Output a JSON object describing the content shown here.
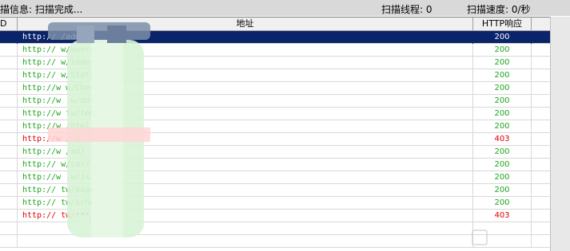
{
  "status": {
    "info": "描信息: 扫描完成...",
    "threads": "扫描线程: 0",
    "speed": "扫描速度: 0/秒"
  },
  "columns": {
    "id": "D",
    "address": "地址",
    "http": "HTTP响应"
  },
  "rows": [
    {
      "address": "http://                        /admin/",
      "http": "200",
      "state": "selected"
    },
    {
      "address": "http://                       w/users/",
      "http": "200",
      "state": "ok"
    },
    {
      "address": "http://                       w/index.htm",
      "http": "200",
      "state": "ok"
    },
    {
      "address": "http://                       w/Stats/",
      "http": "200",
      "state": "ok"
    },
    {
      "address": "http://w                      w/Check/",
      "http": "200",
      "state": "ok"
    },
    {
      "address": "http://w                      .w/docs/",
      "http": "200",
      "state": "ok"
    },
    {
      "address": "http://w                      tw/temp/",
      "http": "200",
      "state": "ok"
    },
    {
      "address": "http://w                       /html/",
      "http": "200",
      "state": "ok"
    },
    {
      "address": "http://w                       /cgi-bin/",
      "http": "403",
      "state": "err"
    },
    {
      "address": "http://w                       /ad/",
      "http": "200",
      "state": "ok"
    },
    {
      "address": "http://                       w/car/",
      "http": "200",
      "state": "ok"
    },
    {
      "address": "http://w                      .w/Js/",
      "http": "200",
      "state": "ok"
    },
    {
      "address": "http://                       tw/pages/",
      "http": "200",
      "state": "ok"
    },
    {
      "address": "http://                       tw/school/",
      "http": "200",
      "state": "ok"
    },
    {
      "address": "http://                       tw/***/",
      "http": "403",
      "state": "err"
    }
  ],
  "colors": {
    "ok": "#1ea51e",
    "error": "#e00000",
    "selection": "#0a246a"
  }
}
